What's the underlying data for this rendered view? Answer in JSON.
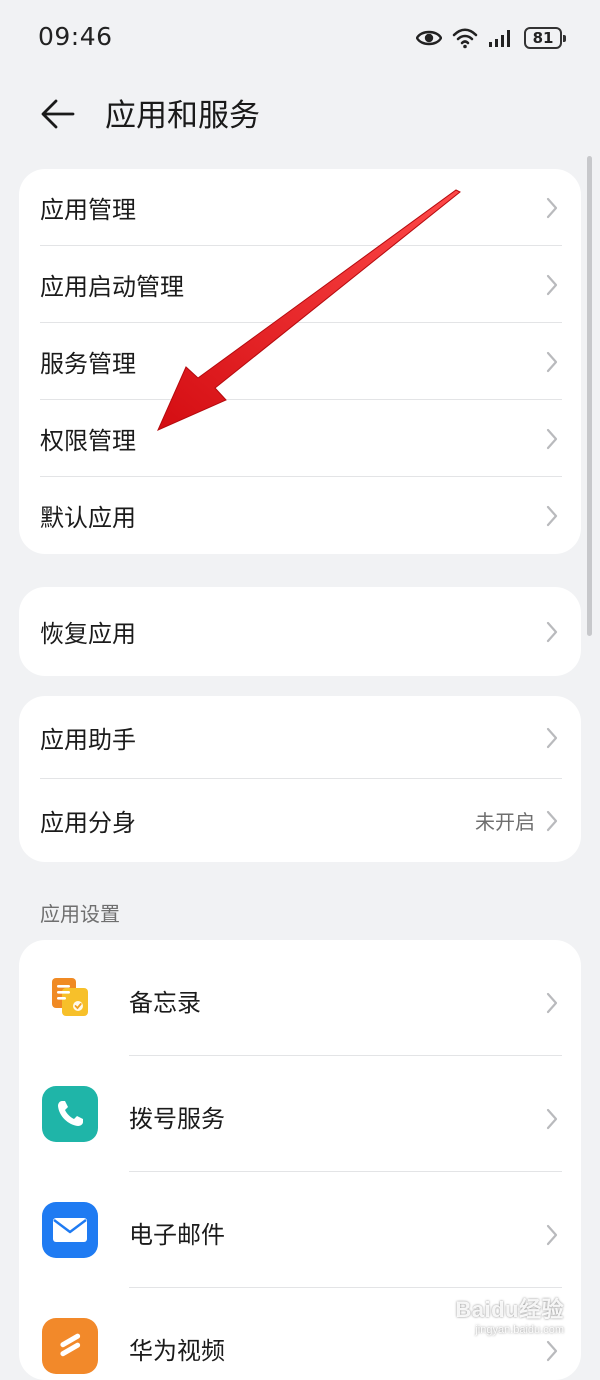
{
  "status_bar": {
    "time": "09:46",
    "battery": "81",
    "icons": [
      "eye-icon",
      "wifi-icon",
      "signal-icon",
      "battery-icon"
    ]
  },
  "header": {
    "title": "应用和服务",
    "back_icon": "back-arrow-icon"
  },
  "card1": {
    "items": [
      {
        "label": "应用管理"
      },
      {
        "label": "应用启动管理"
      },
      {
        "label": "服务管理"
      },
      {
        "label": "权限管理"
      },
      {
        "label": "默认应用"
      }
    ]
  },
  "card2": {
    "items": [
      {
        "label": "恢复应用"
      }
    ]
  },
  "card3": {
    "items": [
      {
        "label": "应用助手",
        "value": ""
      },
      {
        "label": "应用分身",
        "value": "未开启"
      }
    ]
  },
  "app_settings": {
    "title": "应用设置",
    "items": [
      {
        "label": "备忘录",
        "icon": "notepad-icon",
        "color": "#f29a2e"
      },
      {
        "label": "拨号服务",
        "icon": "phone-icon",
        "color": "#1fb5a8"
      },
      {
        "label": "电子邮件",
        "icon": "mail-icon",
        "color": "#1f7bf2"
      },
      {
        "label": "华为视频",
        "icon": "video-icon",
        "color": "#f2892a"
      }
    ]
  },
  "annotation": {
    "color": "#e8141a"
  },
  "watermark": {
    "brand": "Baidu经验",
    "url": "jingyan.baidu.com"
  }
}
